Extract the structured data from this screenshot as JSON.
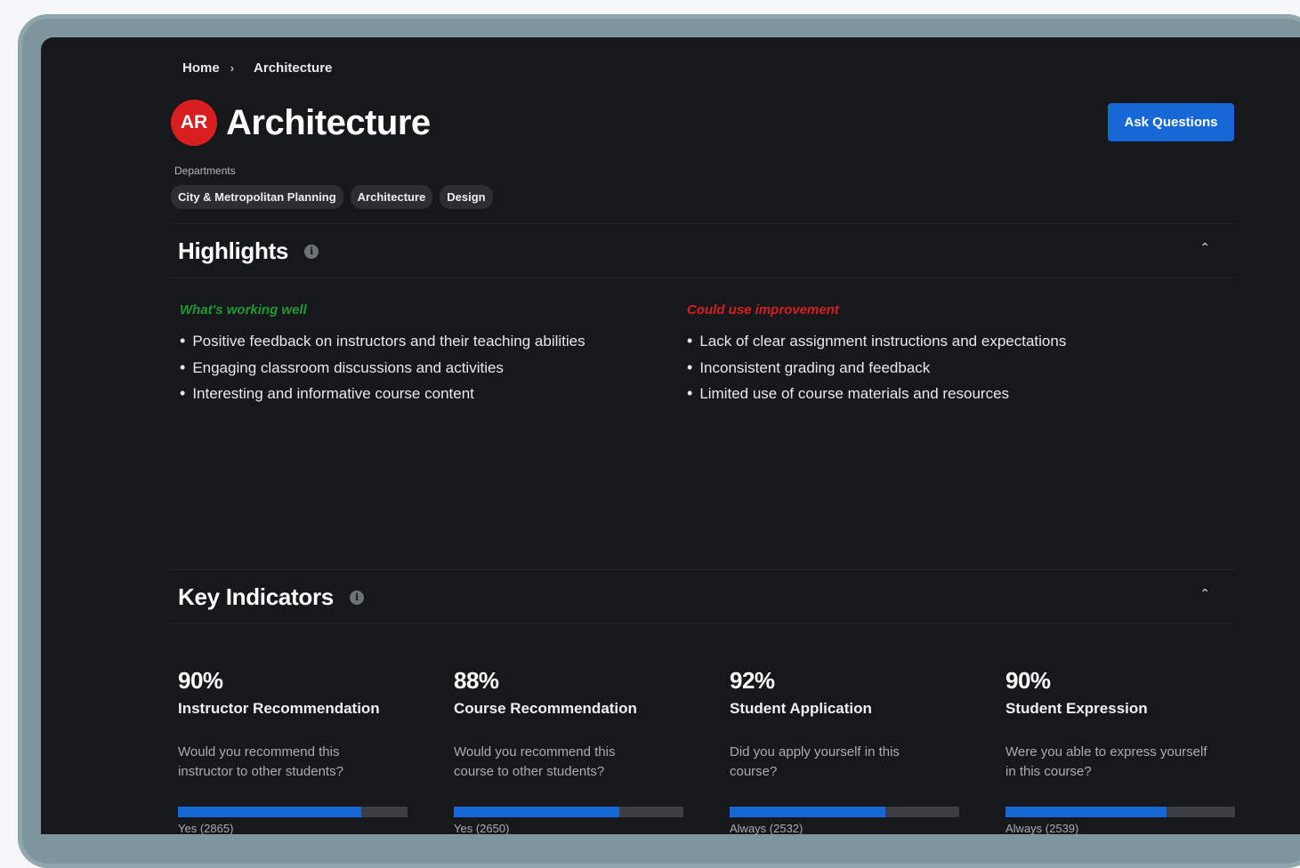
{
  "breadcrumb": {
    "home": "Home",
    "separator": "›",
    "current": "Architecture"
  },
  "header": {
    "avatar_initials": "AR",
    "title": "Architecture",
    "ask_button": "Ask Questions",
    "departments_label": "Departments",
    "departments": [
      "City & Metropolitan Planning",
      "Architecture",
      "Design"
    ]
  },
  "highlights": {
    "title": "Highlights",
    "info_glyph": "i",
    "chevron": "⌃",
    "good": {
      "heading": "What's working well",
      "color": "#1f9a31",
      "items": [
        "Positive feedback on instructors and their teaching abilities",
        "Engaging classroom discussions and activities",
        "Interesting and informative course content"
      ]
    },
    "bad": {
      "heading": "Could use improvement",
      "color": "#d81e1e",
      "items": [
        "Lack of clear assignment instructions and expectations",
        "Inconsistent grading and feedback",
        "Limited use of course materials and resources"
      ]
    }
  },
  "key_indicators": {
    "title": "Key Indicators",
    "info_glyph": "i",
    "chevron": "⌃",
    "accent": "#1668d6",
    "items": [
      {
        "percent": "90%",
        "name": "Instructor Recommendation",
        "question": "Would you recommend this instructor to other students?",
        "answer": "Yes (2865)",
        "fill": 0.8
      },
      {
        "percent": "88%",
        "name": "Course Recommendation",
        "question": "Would you recommend this course to other students?",
        "answer": "Yes (2650)",
        "fill": 0.72
      },
      {
        "percent": "92%",
        "name": "Student Application",
        "question": "Did you apply yourself in this course?",
        "answer": "Always (2532)",
        "fill": 0.68
      },
      {
        "percent": "90%",
        "name": "Student Expression",
        "question": "Were you able to express yourself in this course?",
        "answer": "Always (2539)",
        "fill": 0.7
      }
    ]
  }
}
